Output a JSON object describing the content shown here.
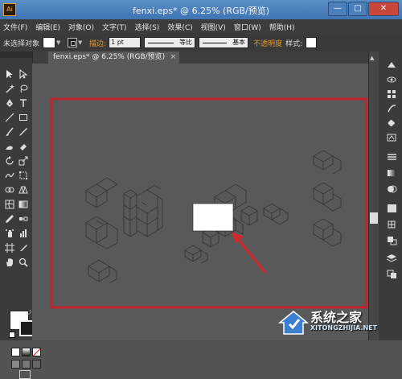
{
  "window": {
    "title": "fenxi.eps* @ 6.25% (RGB/预览)",
    "min": "—",
    "max": "□",
    "close": "✕"
  },
  "menu": [
    "文件(F)",
    "编辑(E)",
    "对象(O)",
    "文字(T)",
    "选择(S)",
    "效果(C)",
    "视图(V)",
    "窗口(W)",
    "帮助(H)"
  ],
  "control": {
    "no_selection": "未选择对象",
    "stroke_label": "描边:",
    "stroke_weight": "1 pt",
    "profile": "等比",
    "brush": "基本",
    "opacity": "不透明度",
    "style": "样式:"
  },
  "document_tab": {
    "label": "fenxi.eps* @ 6.25% (RGB/预览)",
    "close": "×"
  },
  "watermark": {
    "text": "系统之家",
    "url": "XITONGZHIJIA.NET"
  },
  "colors": {
    "accent_red": "#c0272d",
    "arrow_red": "#d0282b",
    "label_orange": "#e59a2e"
  },
  "icons": [
    "selection-icon",
    "direct-selection-icon",
    "magic-wand-icon",
    "lasso-icon",
    "pen-icon",
    "type-icon",
    "line-icon",
    "rectangle-icon",
    "brush-icon",
    "pencil-icon",
    "blob-brush-icon",
    "eraser-icon",
    "rotate-icon",
    "scale-icon",
    "warp-icon",
    "free-transform-icon",
    "shape-builder-icon",
    "perspective-icon",
    "mesh-icon",
    "gradient-icon",
    "eyedropper-icon",
    "blend-icon",
    "symbol-sprayer-icon",
    "graph-icon",
    "artboard-icon",
    "slice-icon",
    "hand-icon",
    "zoom-icon"
  ]
}
